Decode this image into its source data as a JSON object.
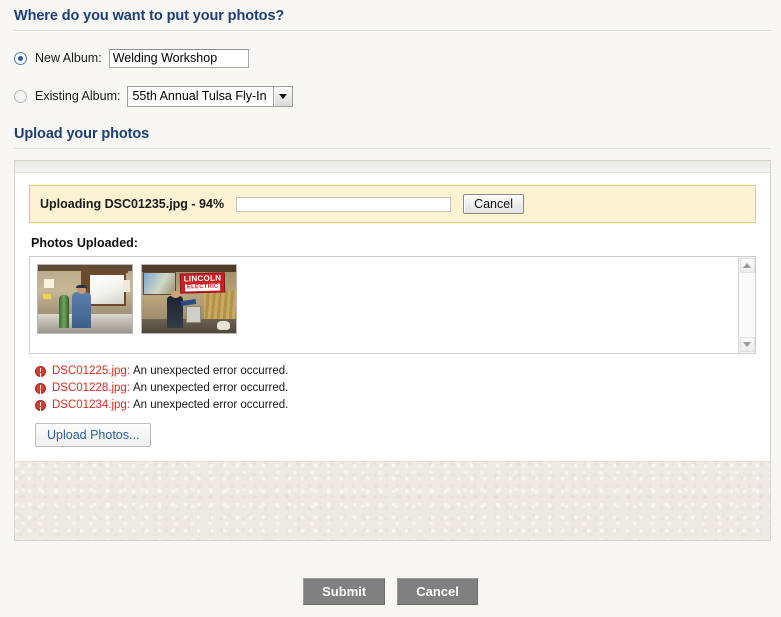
{
  "album_section": {
    "heading": "Where do you want to put your photos?",
    "new_album": {
      "label": "New Album:",
      "value": "Welding Workshop",
      "placeholder": "",
      "selected": true
    },
    "existing_album": {
      "label": "Existing Album:",
      "value": "55th Annual Tulsa Fly-In",
      "selected": false,
      "caret_icon": "chevron-down-icon"
    }
  },
  "upload_section": {
    "heading": "Upload your photos",
    "progress": {
      "label": "Uploading DSC01235.jpg - 94%",
      "percent": 94,
      "fill_color": "#199fd6",
      "banner_bg": "#fdf3d2",
      "banner_border": "#e3c87c",
      "cancel_label": "Cancel"
    },
    "uploaded": {
      "title": "Photos Uploaded:",
      "thumbnails": [
        {
          "alt": "workshop interior with man in blue shirt beside green gas cylinder"
        },
        {
          "alt": "workshop with red LINCOLN ELECTRIC banner and person welding"
        }
      ],
      "banner_text_line1": "LINCOLN",
      "banner_text_line2": "ELECTRIC",
      "scroll_up_icon": "triangle-up-icon",
      "scroll_down_icon": "triangle-down-icon"
    },
    "errors": [
      {
        "icon": "error-icon",
        "file": "DSC01225.jpg:",
        "message": "An unexpected error occurred.",
        "color": "#e02b20"
      },
      {
        "icon": "error-icon",
        "file": "DSC01228.jpg:",
        "message": "An unexpected error occurred.",
        "color": "#e02b20"
      },
      {
        "icon": "error-icon",
        "file": "DSC01234.jpg:",
        "message": "An unexpected error occurred.",
        "color": "#e02b20"
      }
    ],
    "upload_button_label": "Upload Photos..."
  },
  "footer": {
    "submit_label": "Submit",
    "cancel_label": "Cancel"
  }
}
